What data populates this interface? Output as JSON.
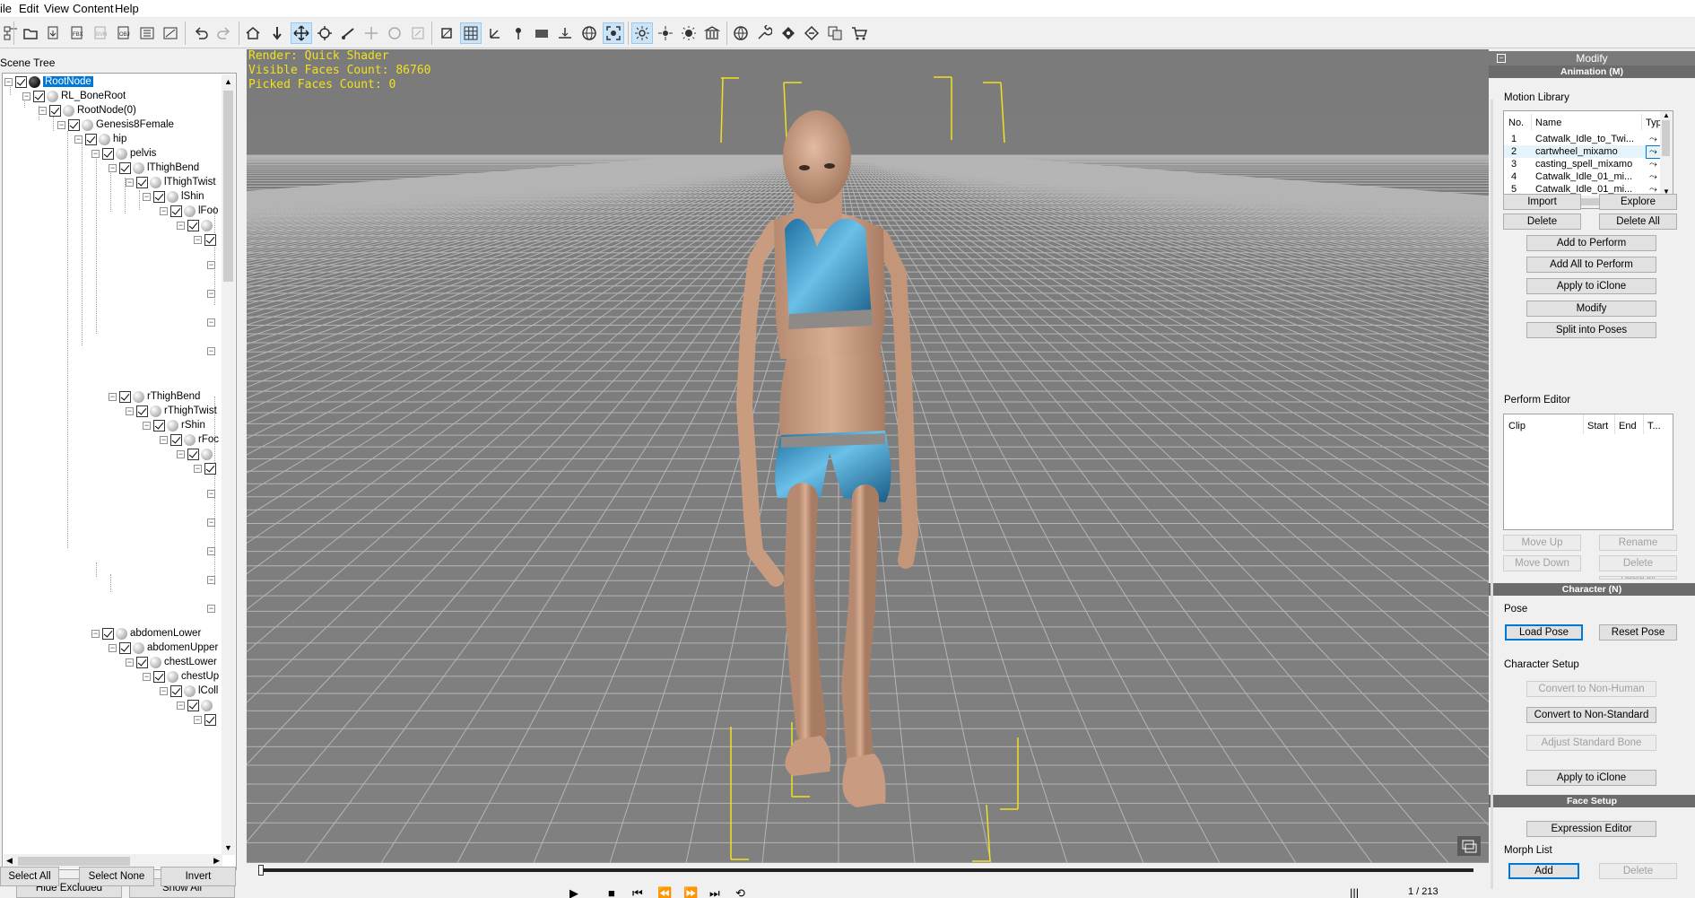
{
  "menu": {
    "file": "ile",
    "edit": "Edit",
    "view": "View",
    "content": "Content",
    "help": "Help"
  },
  "scene_tree": {
    "title": "Scene Tree",
    "nodes": {
      "root": "RootNode",
      "boneroot": "RL_BoneRoot",
      "rootnode0": "RootNode(0)",
      "genesis": "Genesis8Female",
      "hip": "hip",
      "pelvis": "pelvis",
      "lthighbend": "lThighBend",
      "lthightwist": "lThighTwist",
      "lshin": "lShin",
      "lfoot": "lFoo",
      "rthighbend": "rThighBend",
      "rthightwist": "rThighTwist",
      "rshin": "rShin",
      "rfoot": "rFoc",
      "abdomenlower": "abdomenLower",
      "abdomenupper": "abdomenUpper",
      "chestlower": "chestLower",
      "chestupper": "chestUp",
      "lcollar": "lColl"
    },
    "buttons": {
      "hide_excluded": "Hide Excluded",
      "show_all": "Show All",
      "select_all": "Select All",
      "select_none": "Select None",
      "invert": "Invert"
    }
  },
  "viewport": {
    "render": "Render: Quick Shader",
    "visible_faces": "Visible Faces Count: 86760",
    "picked_faces": "Picked Faces Count: 0"
  },
  "timeline": {
    "frame": "1 / 213",
    "progress": 0.0
  },
  "modify": {
    "title": "Modify",
    "animation_header": "Animation (M)",
    "motion_library": {
      "label": "Motion Library",
      "columns": {
        "no": "No.",
        "name": "Name",
        "type": "Type"
      },
      "rows": [
        {
          "no": "1",
          "name": "Catwalk_Idle_to_Twi..."
        },
        {
          "no": "2",
          "name": "cartwheel_mixamo"
        },
        {
          "no": "3",
          "name": "casting_spell_mixamo"
        },
        {
          "no": "4",
          "name": "Catwalk_Idle_01_mi..."
        },
        {
          "no": "5",
          "name": "Catwalk_Idle_01_mi..."
        }
      ]
    },
    "buttons": {
      "import": "Import",
      "explore": "Explore",
      "delete": "Delete",
      "delete_all": "Delete All",
      "add_to_perform": "Add to Perform",
      "add_all_to_perform": "Add All to Perform",
      "apply_to_iclone": "Apply to iClone",
      "modify": "Modify",
      "split_into_poses": "Split into Poses"
    },
    "perform_editor": {
      "label": "Perform Editor",
      "columns": {
        "clip": "Clip",
        "start": "Start",
        "end": "End",
        "t": "T..."
      },
      "buttons": {
        "move_up": "Move Up",
        "rename": "Rename",
        "move_down": "Move Down",
        "delete": "Delete",
        "delete_all": "Delete All"
      }
    },
    "character_header": "Character (N)",
    "pose": {
      "label": "Pose",
      "load": "Load Pose",
      "reset": "Reset Pose"
    },
    "setup": {
      "label": "Character Setup",
      "non_human": "Convert to Non-Human",
      "non_standard": "Convert to Non-Standard",
      "adjust_bone": "Adjust Standard Bone",
      "apply": "Apply to iClone"
    },
    "face_header": "Face Setup",
    "face": {
      "expression_editor": "Expression Editor",
      "morph_list": "Morph List",
      "add": "Add",
      "delete": "Delete"
    }
  },
  "colors": {
    "viewport_bg": "#7a7a7a",
    "grid": "#b5b5b5",
    "overlay_text": "#f0e020",
    "selection": "#0078d7",
    "section_header": "#6b6b6b"
  }
}
